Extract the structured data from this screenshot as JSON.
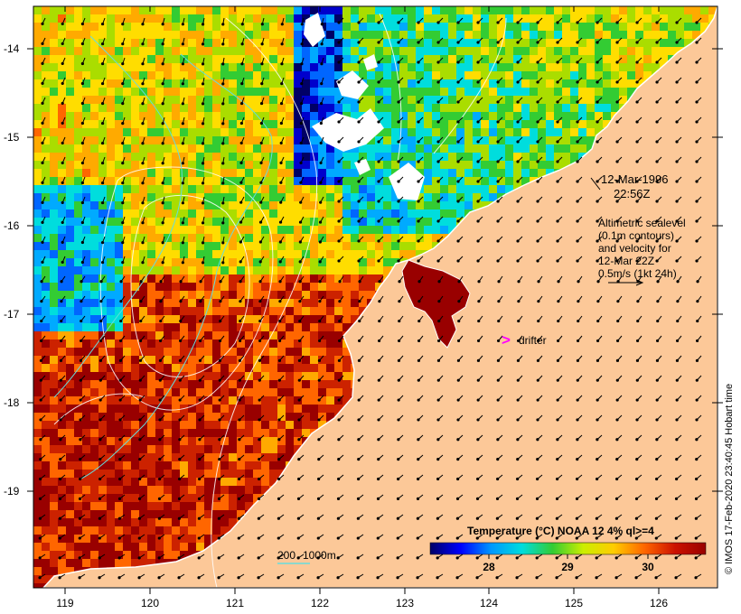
{
  "map": {
    "annotation": {
      "date": "12-Mar-1996",
      "time": "22:56Z",
      "altimetry_lines": [
        "Altimetric sealevel",
        "(0.1m contours)",
        "and velocity for",
        "12-Mar 22Z",
        "0.5m/s (1kt 24h)"
      ]
    },
    "drifter": {
      "symbol": ">",
      "label": "drifter",
      "color": "#ff00ff"
    },
    "isobath_legend": {
      "label1": "200",
      "label2": "1000m",
      "color": "#66dddd"
    },
    "colorbar": {
      "title": "Temperature (°C) NOAA 12 4% ql>=4",
      "ticks": [
        "28",
        "29",
        "30"
      ],
      "stops": [
        "#000066",
        "#0000ff",
        "#0099ff",
        "#00dddd",
        "#33cc33",
        "#ccee00",
        "#ffcc00",
        "#ff6600",
        "#cc1100",
        "#990000"
      ]
    },
    "x_ticks": [
      "119",
      "120",
      "121",
      "122",
      "123",
      "124",
      "125",
      "126"
    ],
    "y_ticks": [
      "-14",
      "-15",
      "-16",
      "-17",
      "-18",
      "-19"
    ],
    "credit": "© IMOS 17-Feb-2020 23:40:45 Hobart time",
    "colors": {
      "land": "#fcc898",
      "coast_line": "#ffffff"
    }
  }
}
